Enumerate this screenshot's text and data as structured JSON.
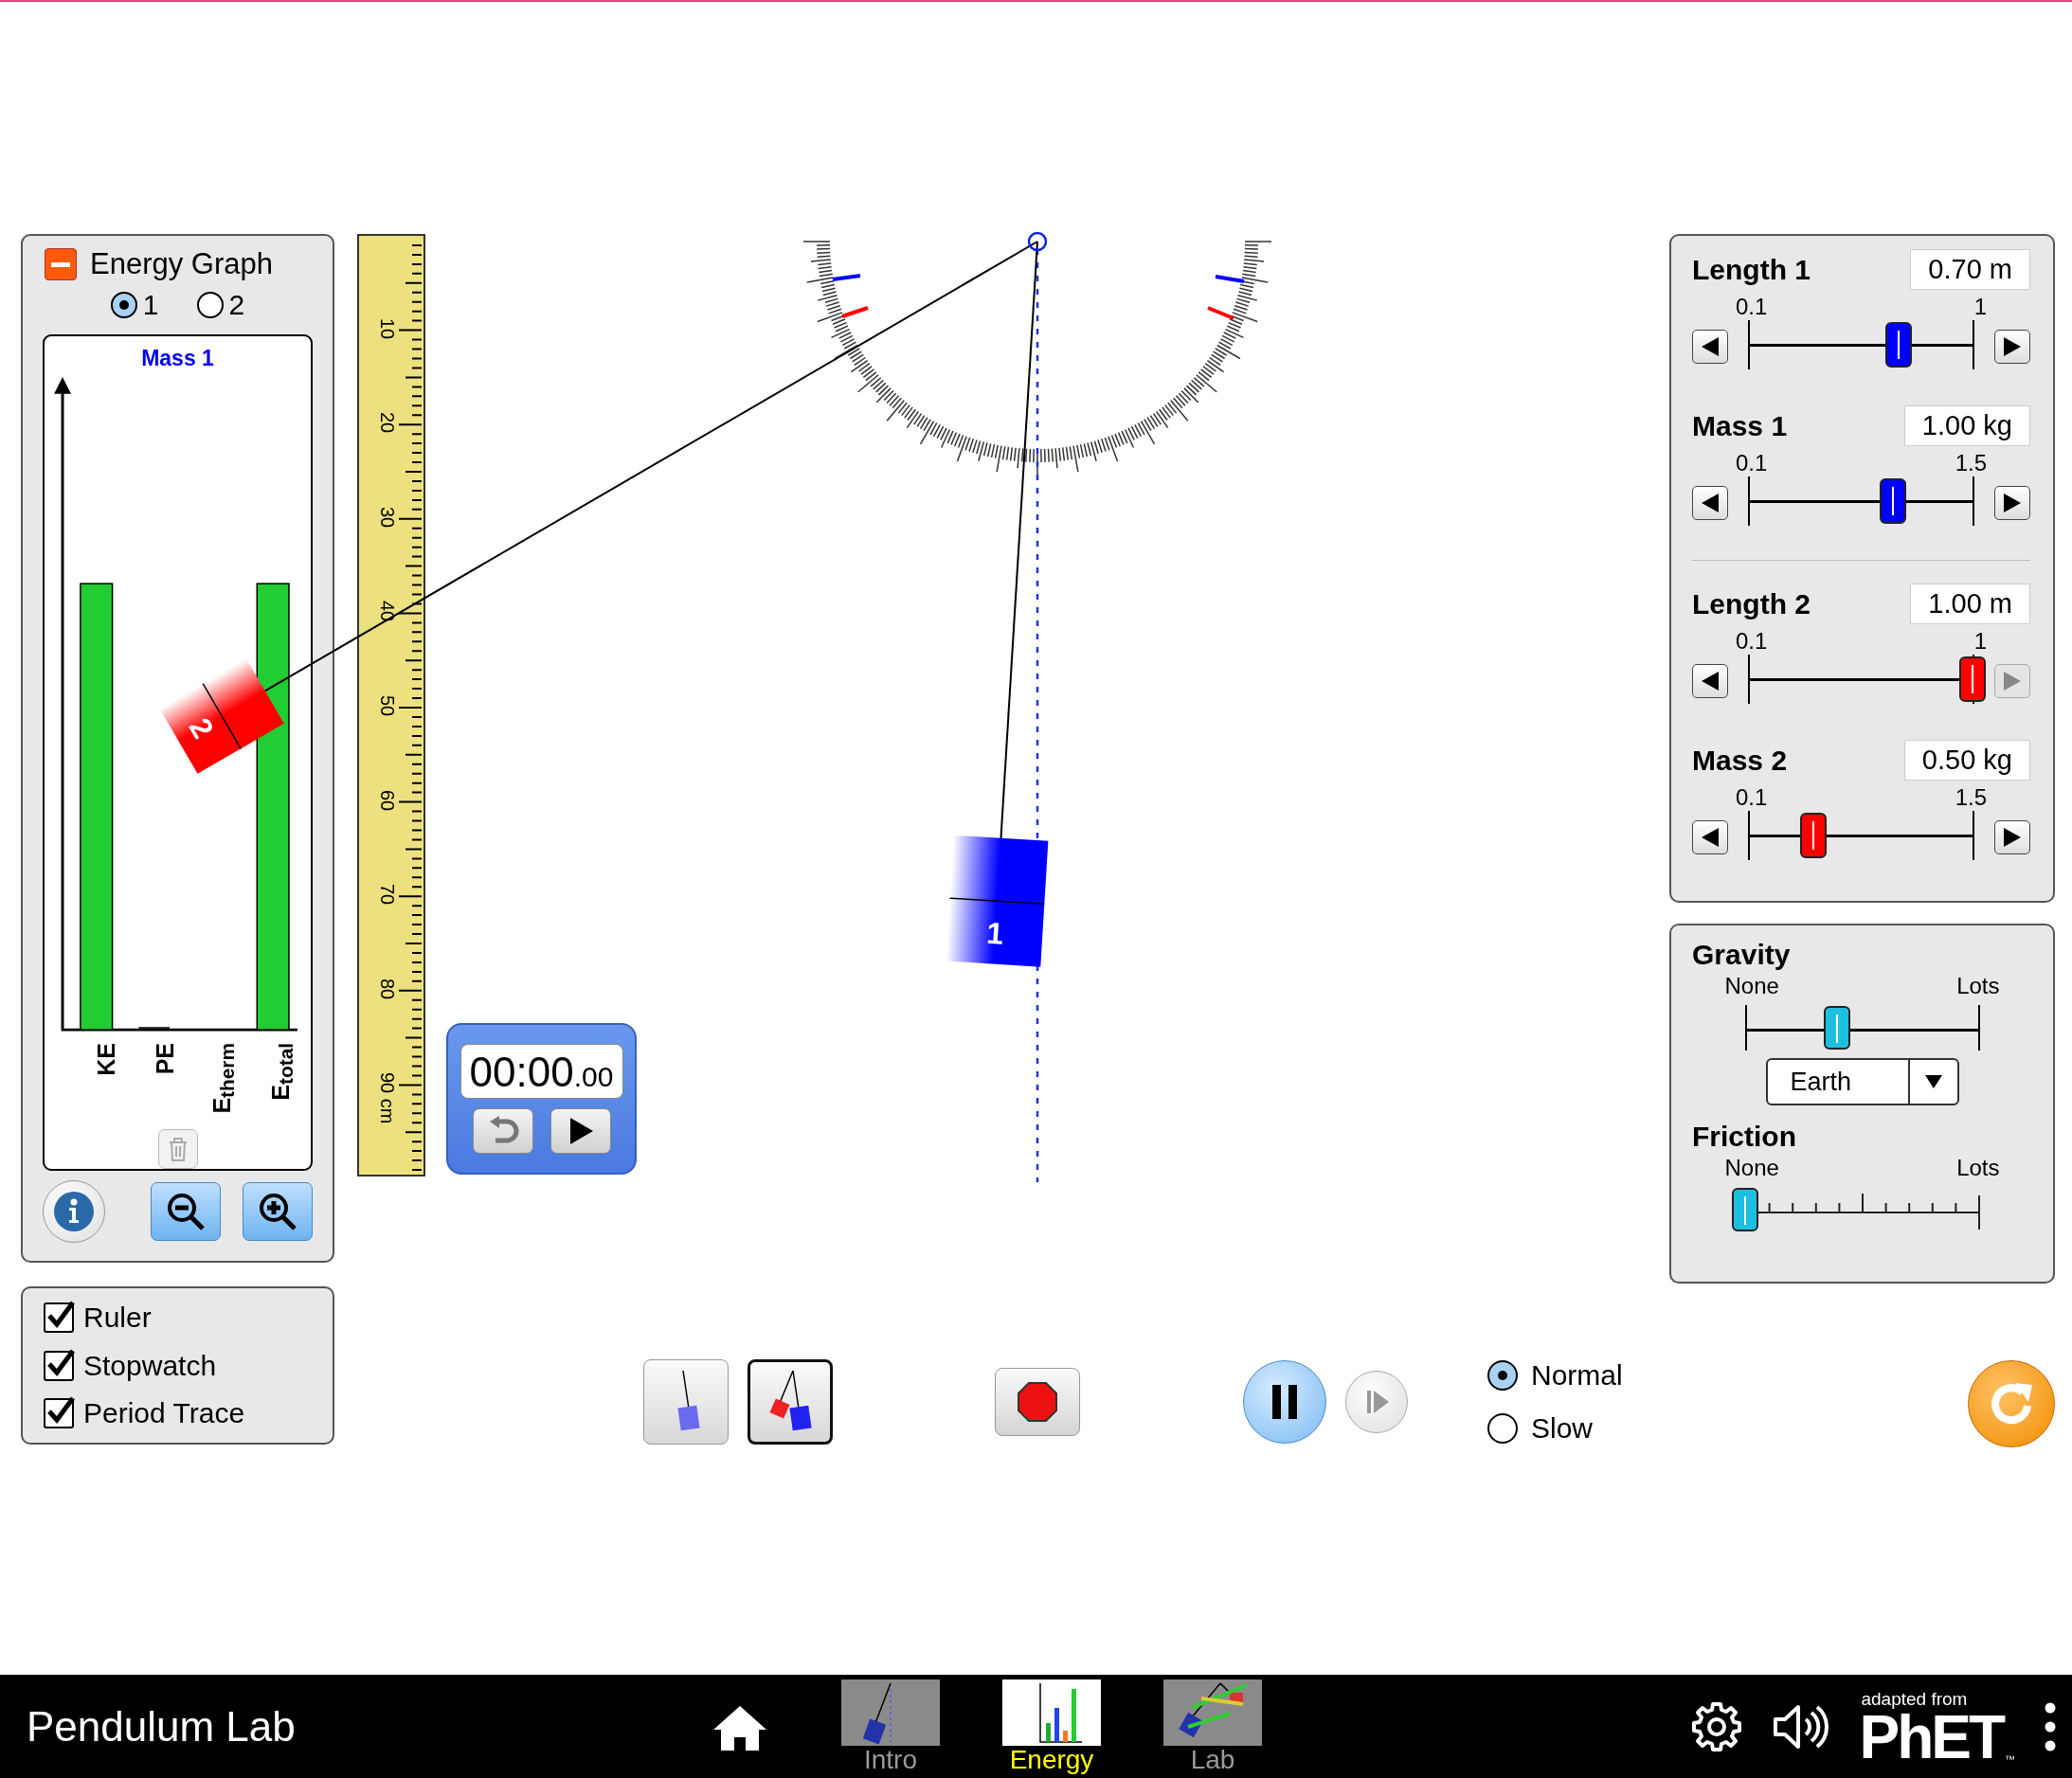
{
  "energy_graph": {
    "title": "Energy Graph",
    "mass_options": [
      {
        "label": "1",
        "selected": true
      },
      {
        "label": "2",
        "selected": false
      }
    ],
    "graph_title": "Mass 1",
    "bar_labels": [
      "KE",
      "PE",
      "E$_{therm}$",
      "E$_{total}$"
    ],
    "clear_disabled": true
  },
  "visibility_checkboxes": [
    {
      "label": "Ruler",
      "checked": true
    },
    {
      "label": "Stopwatch",
      "checked": true
    },
    {
      "label": "Period Trace",
      "checked": true
    }
  ],
  "ruler": {
    "labels": [
      "10",
      "20",
      "30",
      "40",
      "50",
      "60",
      "70",
      "80",
      "90 cm"
    ]
  },
  "stopwatch": {
    "time": "00:00",
    "hundredths": ".00",
    "running": false
  },
  "pendulums": [
    {
      "label": "1",
      "color": "#0000ff"
    },
    {
      "label": "2",
      "color": "#ff0000"
    }
  ],
  "pendulum_controls": [
    {
      "sliders": [
        {
          "label": "Length 1",
          "value": "0.70 m",
          "min": "0.1",
          "max": "1",
          "level": 0.667,
          "increase_disabled": false
        },
        {
          "label": "Mass 1",
          "value": "1.00 kg",
          "min": "0.1",
          "max": "1.5",
          "level": 0.643,
          "increase_disabled": false
        }
      ]
    },
    {
      "sliders": [
        {
          "label": "Length 2",
          "value": "1.00 m",
          "min": "0.1",
          "max": "1",
          "level": 1,
          "increase_disabled": true
        },
        {
          "label": "Mass 2",
          "value": "0.50 kg",
          "min": "0.1",
          "max": "1.5",
          "level": 0.286,
          "increase_disabled": false
        }
      ]
    }
  ],
  "environment": {
    "gravity": {
      "label": "Gravity",
      "min": "None",
      "max": "Lots",
      "level": 0.39,
      "preset": "Earth"
    },
    "friction": {
      "label": "Friction",
      "min": "None",
      "max": "Lots",
      "level": 0
    }
  },
  "pendulum_count_buttons": [
    {
      "kind": "single",
      "selected": false
    },
    {
      "kind": "double",
      "selected": true
    }
  ],
  "playback": {
    "playing": true
  },
  "speed_options": [
    {
      "label": "Normal",
      "selected": true
    },
    {
      "label": "Slow",
      "selected": false
    }
  ],
  "navbar": {
    "title": "Pendulum Lab",
    "tabs": [
      {
        "kind": "intro",
        "label": "Intro",
        "selected": false
      },
      {
        "kind": "energy",
        "label": "Energy",
        "selected": true
      },
      {
        "kind": "lab",
        "label": "Lab",
        "selected": false
      }
    ],
    "logo_caption": "adapted from",
    "logo": "PhET",
    "trademark": "™"
  }
}
